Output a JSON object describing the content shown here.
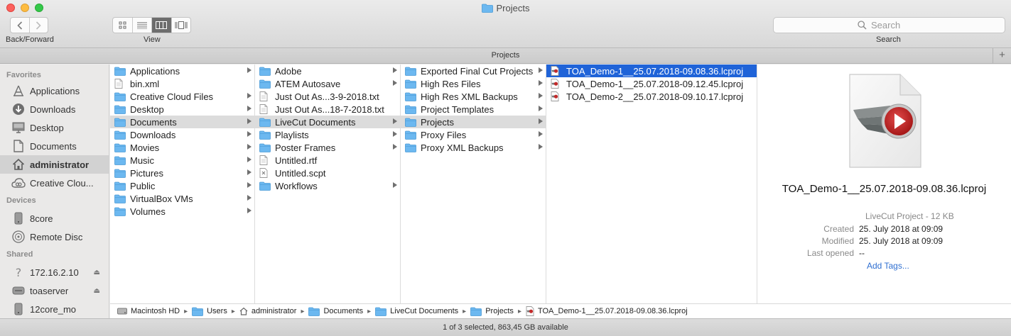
{
  "window": {
    "title": "Projects",
    "tab_title": "Projects"
  },
  "toolbar": {
    "back_forward_label": "Back/Forward",
    "view_label": "View",
    "search_label": "Search",
    "search_placeholder": "Search"
  },
  "sidebar": {
    "favorites_header": "Favorites",
    "favorites": [
      {
        "label": "Applications",
        "icon": "applications-icon"
      },
      {
        "label": "Downloads",
        "icon": "downloads-icon"
      },
      {
        "label": "Desktop",
        "icon": "desktop-icon"
      },
      {
        "label": "Documents",
        "icon": "documents-icon"
      },
      {
        "label": "administrator",
        "icon": "home-icon",
        "selected": true
      },
      {
        "label": "Creative Clou...",
        "icon": "creative-cloud-icon"
      }
    ],
    "devices_header": "Devices",
    "devices": [
      {
        "label": "8core",
        "icon": "disk-icon"
      },
      {
        "label": "Remote Disc",
        "icon": "remote-disc-icon"
      }
    ],
    "shared_header": "Shared",
    "shared": [
      {
        "label": "172.16.2.10",
        "icon": "question-server-icon",
        "eject": true
      },
      {
        "label": "toaserver",
        "icon": "server-icon",
        "eject": true
      },
      {
        "label": "12core_mo",
        "icon": "disk-icon"
      }
    ]
  },
  "columns": {
    "col1": [
      {
        "label": "Applications",
        "type": "folder",
        "arrow": true
      },
      {
        "label": "bin.xml",
        "type": "file",
        "arrow": false
      },
      {
        "label": "Creative Cloud Files",
        "type": "folder",
        "arrow": true
      },
      {
        "label": "Desktop",
        "type": "folder",
        "arrow": true
      },
      {
        "label": "Documents",
        "type": "folder",
        "arrow": true,
        "selected": true
      },
      {
        "label": "Downloads",
        "type": "folder",
        "arrow": true
      },
      {
        "label": "Movies",
        "type": "folder",
        "arrow": true
      },
      {
        "label": "Music",
        "type": "folder",
        "arrow": true
      },
      {
        "label": "Pictures",
        "type": "folder",
        "arrow": true
      },
      {
        "label": "Public",
        "type": "folder",
        "arrow": true
      },
      {
        "label": "VirtualBox VMs",
        "type": "folder",
        "arrow": true
      },
      {
        "label": "Volumes",
        "type": "folder",
        "arrow": true
      }
    ],
    "col2": [
      {
        "label": "Adobe",
        "type": "folder",
        "arrow": true
      },
      {
        "label": "ATEM Autosave",
        "type": "folder",
        "arrow": true
      },
      {
        "label": "Just Out As...3-9-2018.txt",
        "type": "file",
        "arrow": false
      },
      {
        "label": "Just Out As...18-7-2018.txt",
        "type": "file",
        "arrow": false
      },
      {
        "label": "LiveCut Documents",
        "type": "folder",
        "arrow": true,
        "selected": true
      },
      {
        "label": "Playlists",
        "type": "folder",
        "arrow": true
      },
      {
        "label": "Poster Frames",
        "type": "folder",
        "arrow": true
      },
      {
        "label": "Untitled.rtf",
        "type": "file",
        "arrow": false
      },
      {
        "label": "Untitled.scpt",
        "type": "script",
        "arrow": false
      },
      {
        "label": "Workflows",
        "type": "folder",
        "arrow": true
      }
    ],
    "col3": [
      {
        "label": "Exported Final Cut Projects",
        "type": "folder",
        "arrow": true
      },
      {
        "label": "High Res Files",
        "type": "folder",
        "arrow": true
      },
      {
        "label": "High Res XML Backups",
        "type": "folder",
        "arrow": true
      },
      {
        "label": "Project Templates",
        "type": "folder",
        "arrow": true
      },
      {
        "label": "Projects",
        "type": "folder",
        "arrow": true,
        "selected": true
      },
      {
        "label": "Proxy Files",
        "type": "folder",
        "arrow": true
      },
      {
        "label": "Proxy XML Backups",
        "type": "folder",
        "arrow": true
      }
    ],
    "col4": [
      {
        "label": "TOA_Demo-1__25.07.2018-09.08.36.lcproj",
        "type": "lcproj",
        "active": true
      },
      {
        "label": "TOA_Demo-1__25.07.2018-09.12.45.lcproj",
        "type": "lcproj"
      },
      {
        "label": "TOA_Demo-2__25.07.2018-09.10.17.lcproj",
        "type": "lcproj"
      }
    ]
  },
  "preview": {
    "name": "TOA_Demo-1__25.07.2018-09.08.36.lcproj",
    "kind": "LiveCut Project - 12 KB",
    "created_label": "Created",
    "created": "25. July 2018 at 09:09",
    "modified_label": "Modified",
    "modified": "25. July 2018 at 09:09",
    "last_opened_label": "Last opened",
    "last_opened": "--",
    "add_tags": "Add Tags..."
  },
  "pathbar": [
    {
      "label": "Macintosh HD",
      "icon": "hd"
    },
    {
      "label": "Users",
      "icon": "folder"
    },
    {
      "label": "administrator",
      "icon": "home"
    },
    {
      "label": "Documents",
      "icon": "folder"
    },
    {
      "label": "LiveCut Documents",
      "icon": "folder"
    },
    {
      "label": "Projects",
      "icon": "folder"
    },
    {
      "label": "TOA_Demo-1__25.07.2018-09.08.36.lcproj",
      "icon": "lcproj"
    }
  ],
  "status": {
    "text": "1 of 3 selected, 863,45 GB available"
  },
  "colors": {
    "selection": "#1f63d8",
    "folder": "#6cb8f0",
    "accent_link": "#2f6fd1"
  }
}
